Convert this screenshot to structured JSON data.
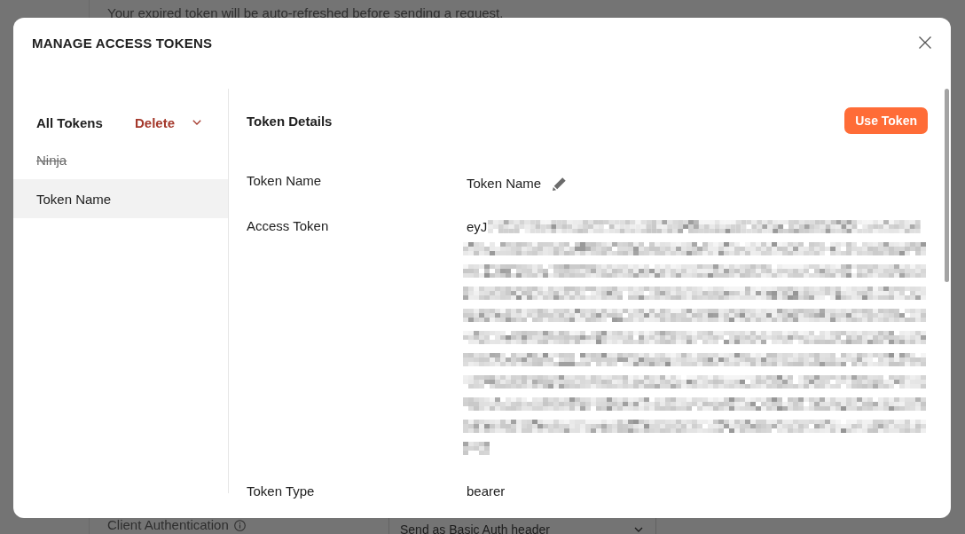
{
  "background": {
    "notice": "Your expired token will be auto-refreshed before sending a request.",
    "client_auth": {
      "label": "Client Authentication",
      "value": "Send as Basic Auth header"
    }
  },
  "dialog": {
    "title": "MANAGE ACCESS TOKENS"
  },
  "sidebar": {
    "heading": "All Tokens",
    "delete_label": "Delete",
    "items": [
      {
        "name": "Ninja",
        "crossed_out": true,
        "selected": false
      },
      {
        "name": "Token Name",
        "crossed_out": false,
        "selected": true
      }
    ]
  },
  "details": {
    "heading": "Token Details",
    "use_button": "Use Token",
    "fields": [
      {
        "label": "Token Name",
        "value": "Token Name",
        "kind": "editable"
      },
      {
        "label": "Access Token",
        "value": "eyJ",
        "kind": "redacted"
      },
      {
        "label": "Token Type",
        "value": "bearer",
        "kind": "plain"
      }
    ]
  }
}
